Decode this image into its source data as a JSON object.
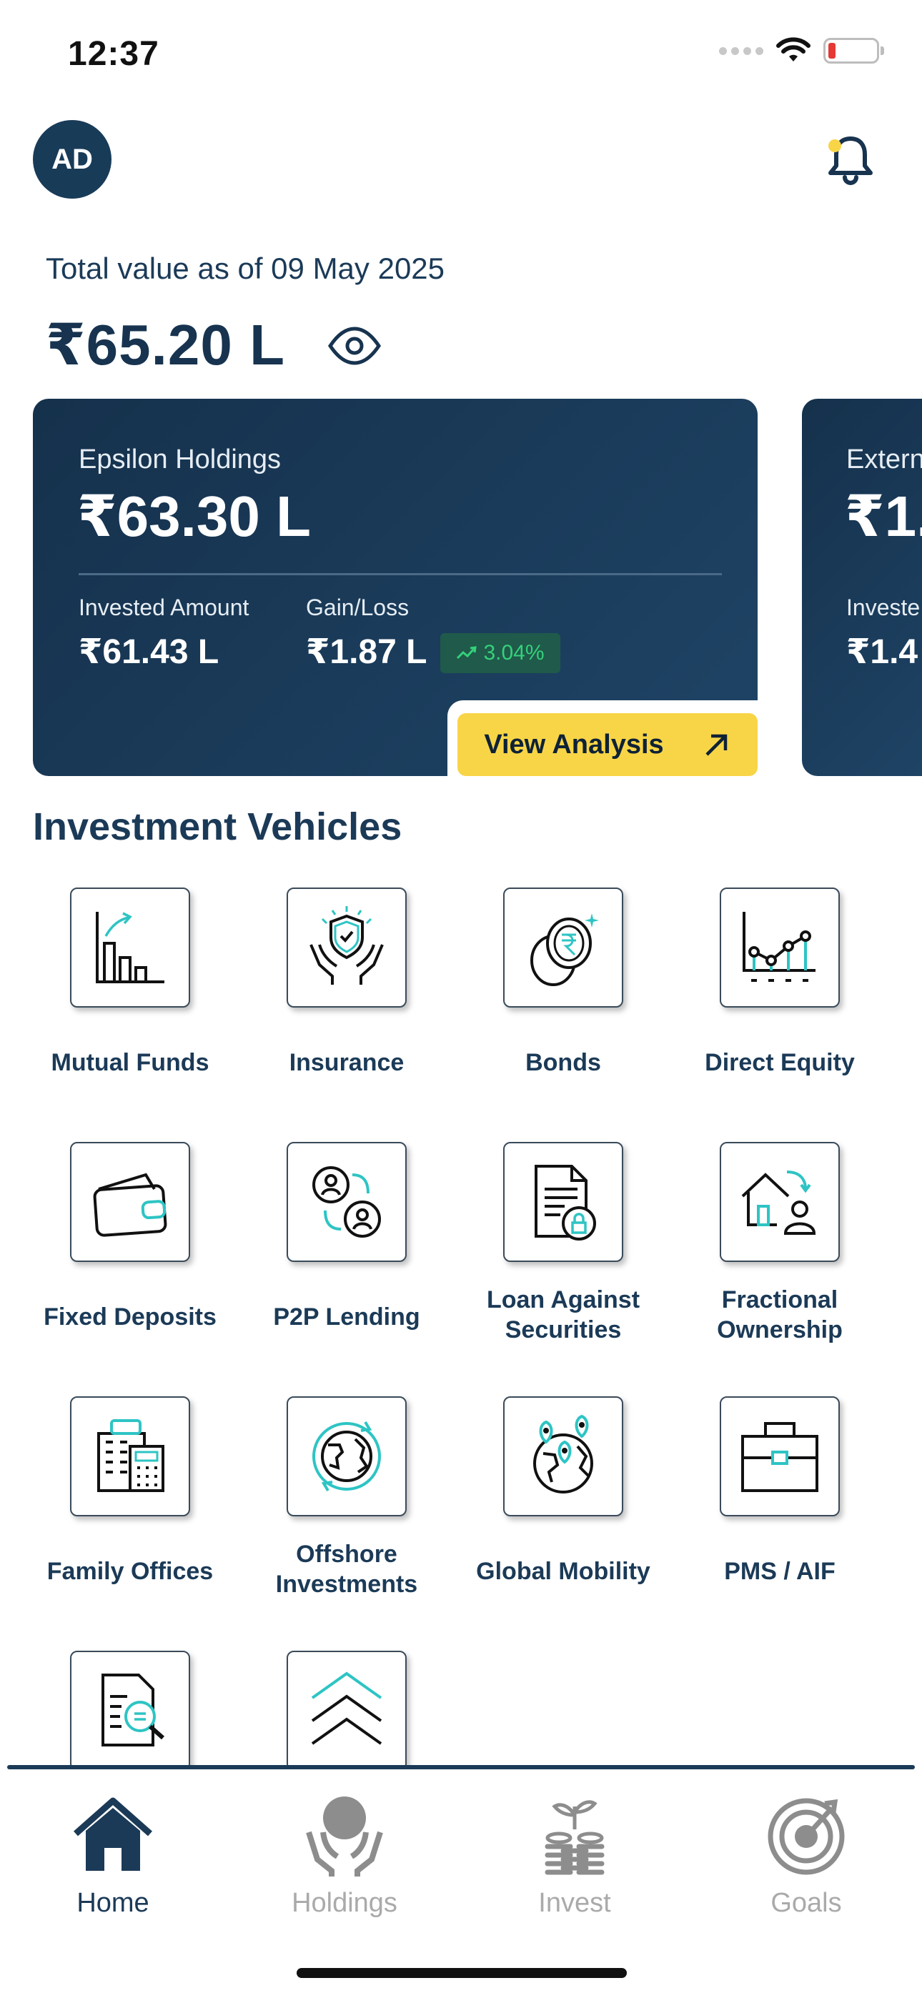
{
  "status": {
    "time": "12:37"
  },
  "header": {
    "avatar_initials": "AD"
  },
  "summary": {
    "total_label": "Total value as of 09 May 2025",
    "total_value": "₹65.20 L"
  },
  "card": {
    "title": "Epsilon Holdings",
    "value": "₹63.30 L",
    "invested_label": "Invested Amount",
    "invested_value": "₹61.43 L",
    "gain_label": "Gain/Loss",
    "gain_value": "₹1.87 L",
    "gain_percent": "3.04%",
    "view_label": "View Analysis"
  },
  "card2": {
    "title": "Extern",
    "value": "₹1.",
    "invested_label": "Investe",
    "invested_value": "₹1.4"
  },
  "section": {
    "title": "Investment Vehicles"
  },
  "vehicles": [
    {
      "label": "Mutual Funds"
    },
    {
      "label": "Insurance"
    },
    {
      "label": "Bonds"
    },
    {
      "label": "Direct Equity"
    },
    {
      "label": "Fixed Deposits"
    },
    {
      "label": "P2P Lending"
    },
    {
      "label": "Loan Against Securities"
    },
    {
      "label": "Fractional Ownership"
    },
    {
      "label": "Family Offices"
    },
    {
      "label": "Offshore Investments"
    },
    {
      "label": "Global Mobility"
    },
    {
      "label": "PMS / AIF"
    }
  ],
  "nav": [
    {
      "label": "Home"
    },
    {
      "label": "Holdings"
    },
    {
      "label": "Invest"
    },
    {
      "label": "Goals"
    }
  ],
  "colors": {
    "primary": "#1b3a57",
    "accent_yellow": "#f8d547",
    "teal": "#2ec4c4",
    "gain_green": "#35d07a"
  }
}
